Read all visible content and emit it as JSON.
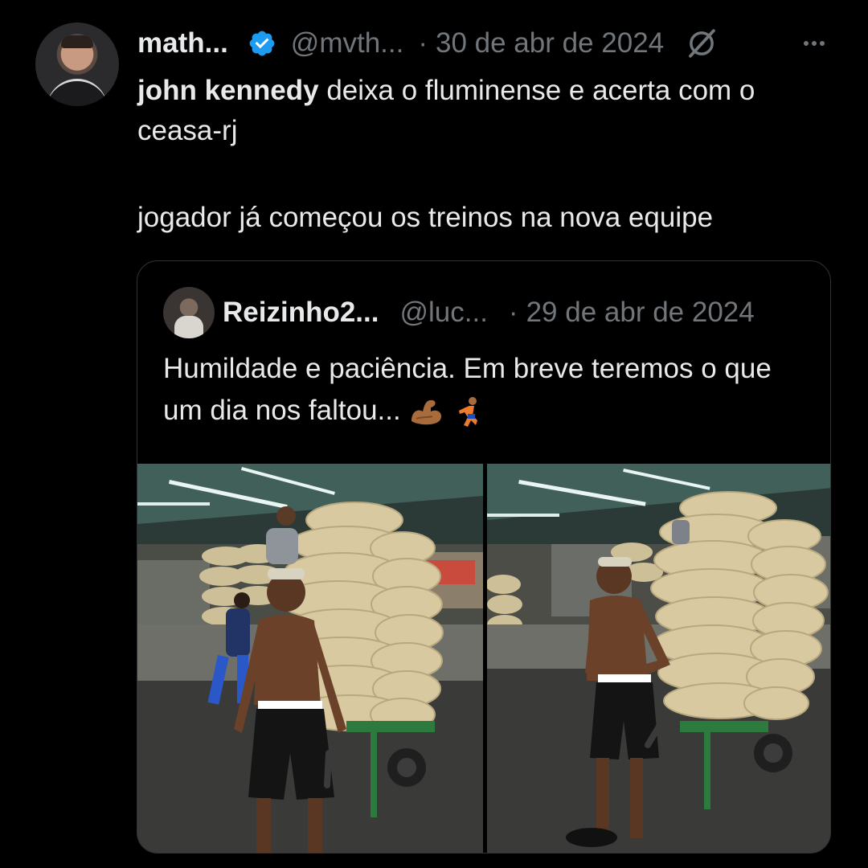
{
  "tweet": {
    "author_name": "math...",
    "handle": "@mvth...",
    "separator": "·",
    "date": "30 de abr de 2024",
    "text_bold": "john kennedy",
    "text_line1_rest": " deixa o fluminense e acerta com o ceasa-rj",
    "text_line2": "jogador já começou os treinos na nova equipe",
    "verified": true,
    "avatar_icon": "user-avatar",
    "grok_icon": "grok-icon",
    "more_icon": "more-options-icon"
  },
  "quote": {
    "author_name": "Reizinho2...",
    "handle": "@luc...",
    "separator": "·",
    "date": "29 de abr de 2024",
    "text": "Humildade e paciência. Em breve teremos o que um dia nos faltou...",
    "emojis": [
      "flexed-biceps-emoji",
      "person-running-emoji"
    ],
    "photos": [
      "market-photo-1",
      "market-photo-2"
    ]
  },
  "colors": {
    "background": "#000000",
    "text_primary": "#e7e9ea",
    "text_secondary": "#71767b",
    "verified": "#1d9bf0",
    "border": "#2f3336"
  }
}
